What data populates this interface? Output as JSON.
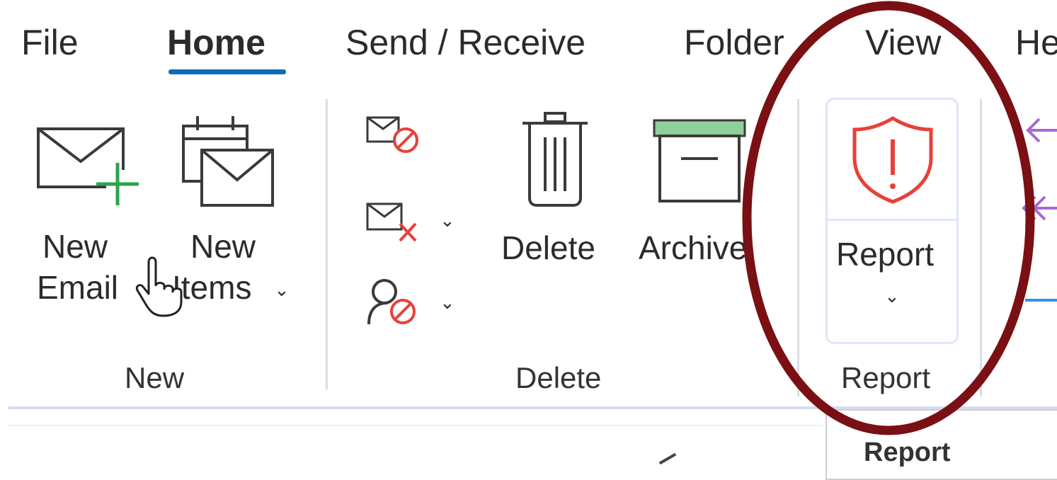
{
  "ribbon_tabs": {
    "file": "File",
    "home": "Home",
    "send_receive": "Send / Receive",
    "folder": "Folder",
    "view": "View",
    "help": "He"
  },
  "new_group": {
    "new_email_line1": "New",
    "new_email_line2": "Email",
    "new_items_line1": "New",
    "new_items_line2": "Items",
    "group_label": "New"
  },
  "delete_group": {
    "delete_label": "Delete",
    "archive_label": "Archive",
    "group_label": "Delete"
  },
  "report_group": {
    "report_label": "Report",
    "group_label": "Report"
  },
  "tooltip": {
    "title": "Report"
  },
  "icons": {
    "new_email": "envelope-plus-icon",
    "new_items": "calendar-envelope-icon",
    "ignore": "ignore-icon",
    "clean_up": "clean-up-icon",
    "block_sender": "block-sender-icon",
    "delete": "trash-icon",
    "archive": "archive-box-icon",
    "report": "shield-warning-icon"
  },
  "colors": {
    "tab_underline": "#0f6cbd",
    "highlight_ellipse": "#7a0f14",
    "shield": "#e8403a",
    "archive_lid": "#8fcf9a",
    "plus": "#2da44e",
    "block_red": "#e8403a"
  }
}
